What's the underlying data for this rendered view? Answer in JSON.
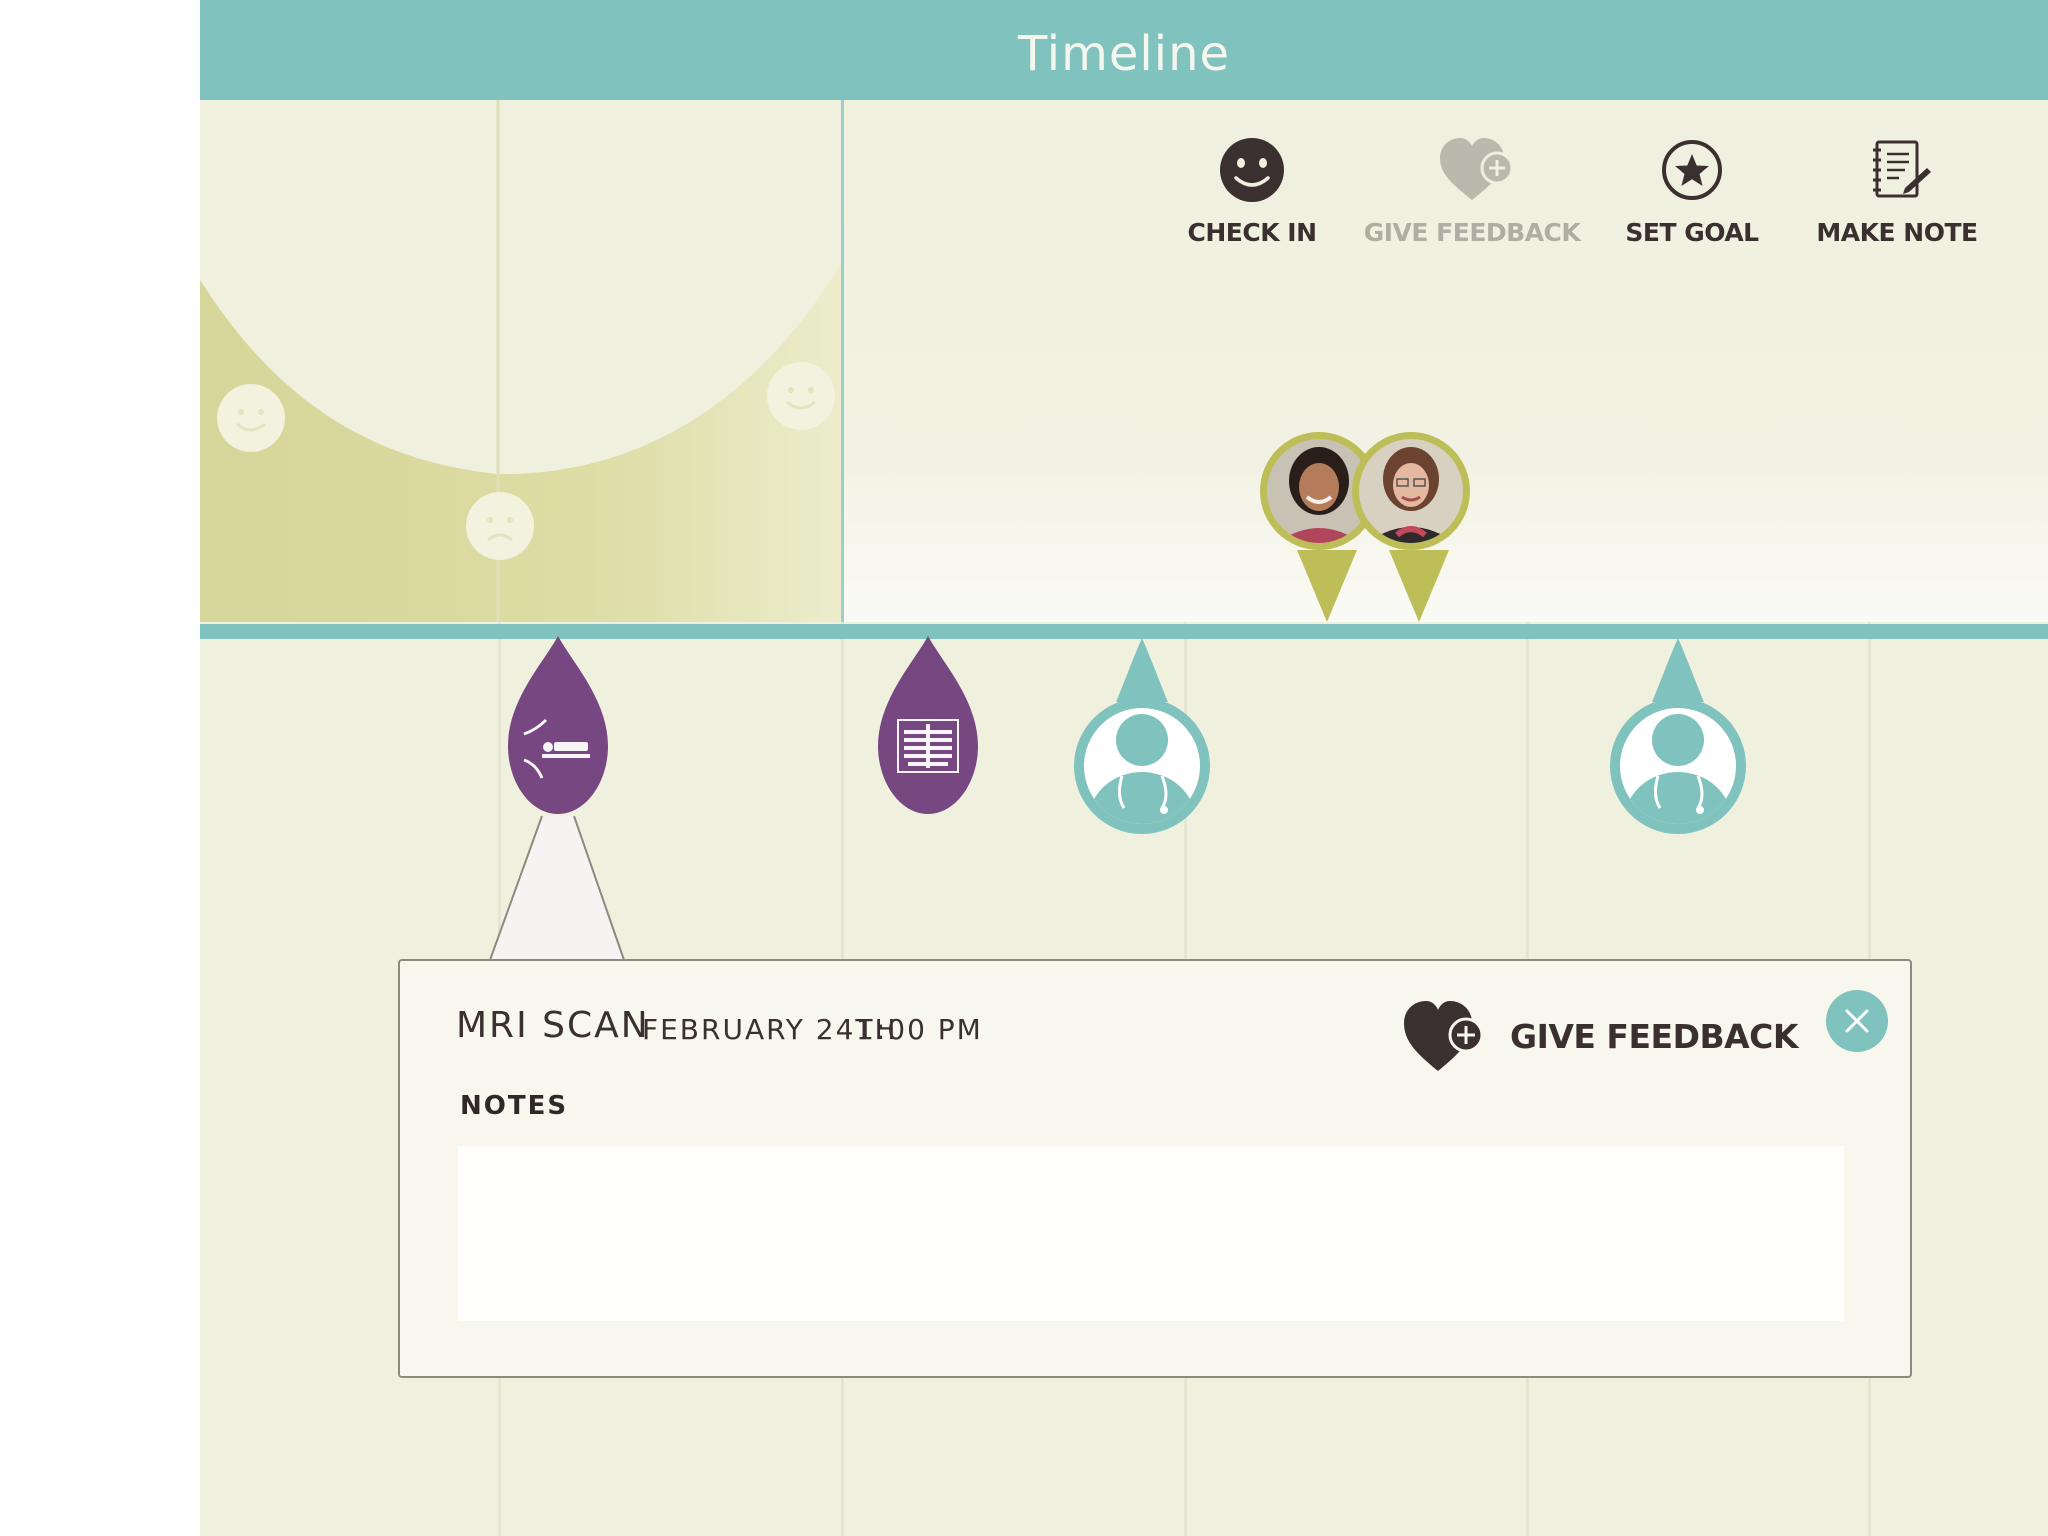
{
  "header": {
    "title": "Timeline"
  },
  "actions": [
    {
      "label": "CHECK IN",
      "icon": "smiley-icon",
      "enabled": true
    },
    {
      "label": "GIVE FEEDBACK",
      "icon": "heart-plus-icon",
      "enabled": false
    },
    {
      "label": "SET GOAL",
      "icon": "star-circle-icon",
      "enabled": true
    },
    {
      "label": "MAKE NOTE",
      "icon": "notebook-pencil-icon",
      "enabled": true
    }
  ],
  "mood_chart": {
    "faces": [
      "happy",
      "sad",
      "happy"
    ]
  },
  "avatars": [
    {
      "icon": "person-photo-icon"
    },
    {
      "icon": "person-photo-icon"
    }
  ],
  "timeline_events": [
    {
      "type": "mri-scan",
      "icon": "mri-scanner-icon",
      "color": "#764780",
      "selected": true
    },
    {
      "type": "x-ray",
      "icon": "xray-chest-icon",
      "color": "#764780",
      "selected": false
    },
    {
      "type": "doctor-visit",
      "icon": "doctor-icon",
      "color": "#80c2be",
      "selected": false
    },
    {
      "type": "doctor-visit",
      "icon": "doctor-icon",
      "color": "#80c2be",
      "selected": false
    }
  ],
  "detail": {
    "title": "MRI SCAN",
    "date": "FEBRUARY 24TH",
    "time": "1:00 PM",
    "feedback_label": "GIVE FEEDBACK",
    "notes_label": "NOTES",
    "notes_value": "",
    "close_icon": "close-icon"
  },
  "colors": {
    "accent": "#80c2be",
    "event_purple": "#764780",
    "mood_fill": "#d6d69a",
    "avatar_ring": "#bdbe58",
    "background": "#f0f0df",
    "text": "#3b3030"
  }
}
